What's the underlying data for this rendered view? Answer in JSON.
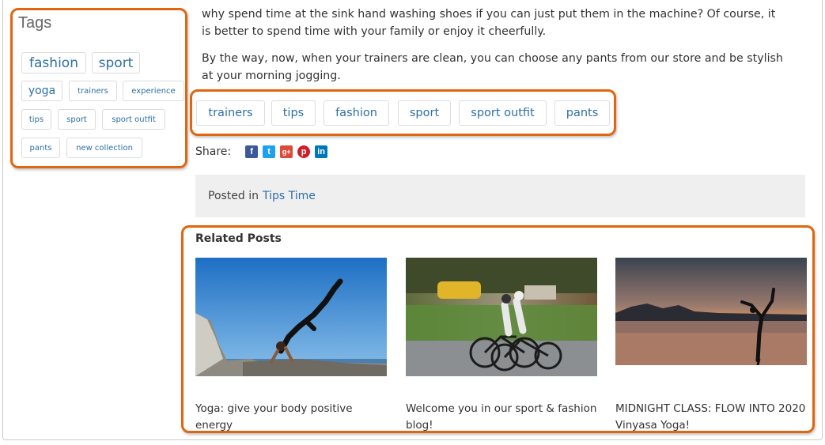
{
  "sidebar": {
    "title": "Tags",
    "tags": [
      "fashion",
      "sport",
      "yoga",
      "trainers",
      "experience",
      "tips",
      "sport",
      "sport outfit",
      "pants",
      "new collection"
    ]
  },
  "article": {
    "para1_line1": "why spend time at the sink hand washing shoes if you can just put them in the machine? Of course, it",
    "para1_line2": "is better to spend time with your family or enjoy it cheerfully.",
    "para2_line1": "By the way, now, when your trainers are clean, you can choose any pants from our store and be stylish",
    "para2_line2": "at your morning jogging."
  },
  "post_tags": [
    "trainers",
    "tips",
    "fashion",
    "sport",
    "sport outfit",
    "pants"
  ],
  "share": {
    "label": "Share:",
    "icons": [
      "facebook-icon",
      "twitter-icon",
      "google-plus-icon",
      "pinterest-icon",
      "linkedin-icon"
    ],
    "glyphs": [
      "f",
      "t",
      "g+",
      "p",
      "in"
    ]
  },
  "posted_in": {
    "prefix": "Posted in",
    "category": "Tips Time"
  },
  "related": {
    "heading": "Related Posts",
    "posts": [
      {
        "title_line1": "Yoga: give your body positive energy",
        "title_line2": ""
      },
      {
        "title_line1": "Welcome you in our sport & fashion",
        "title_line2": "blog!"
      },
      {
        "title_line1": "MIDNIGHT CLASS: FLOW INTO 2020",
        "title_line2": "Vinyasa Yoga!"
      }
    ]
  },
  "colors": {
    "highlight": "#e0660f",
    "link": "#2e6fa6",
    "facebook": "#3b5998",
    "twitter": "#1da1f2",
    "google_plus": "#dd4b39",
    "pinterest": "#cb2027",
    "linkedin": "#0077b5"
  }
}
